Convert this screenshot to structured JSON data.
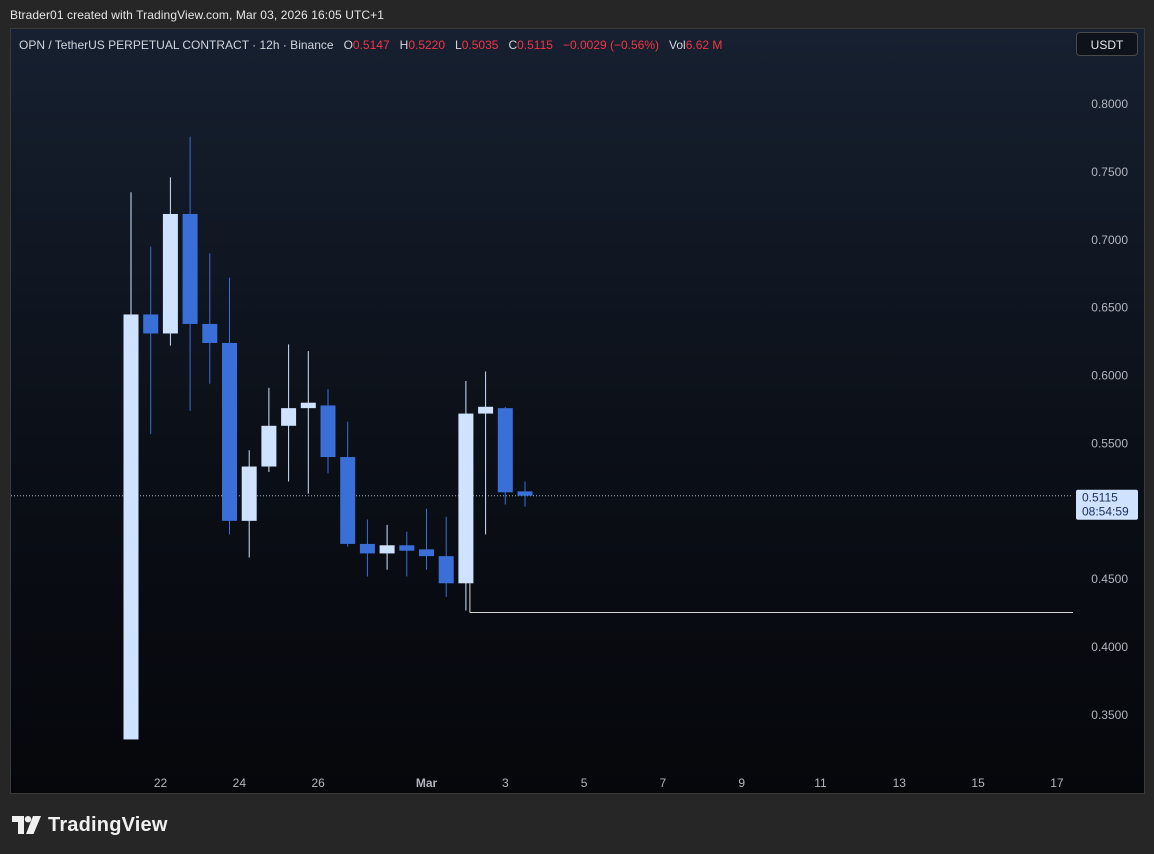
{
  "header": {
    "author_line": "Btrader01 created with TradingView.com, Mar 03, 2026 16:05 UTC+1"
  },
  "legend": {
    "symbol": "OPN / TetherUS PERPETUAL CONTRACT · 12h · Binance",
    "o_label": "O",
    "o_value": "0.5147",
    "h_label": "H",
    "h_value": "0.5220",
    "l_label": "L",
    "l_value": "0.5035",
    "c_label": "C",
    "c_value": "0.5115",
    "change": "−0.0029 (−0.56%)",
    "vol_label": "Vol",
    "vol_value": "6.62 M"
  },
  "currency_button": "USDT",
  "price_tag": {
    "price": "0.5115",
    "countdown": "08:54:59"
  },
  "footer": {
    "brand": "TradingView"
  },
  "colors": {
    "up": "#cfe2ff",
    "down": "#3a6fd8",
    "legend_value": "#f23645",
    "price_tag_bg": "#cfe2ff",
    "price_tag_text": "#1a2f5a"
  },
  "chart_data": {
    "type": "candlestick",
    "y_ticks": [
      "0.8000",
      "0.7500",
      "0.7000",
      "0.6500",
      "0.6000",
      "0.5500",
      "0.4500",
      "0.4000",
      "0.3500"
    ],
    "x_ticks": [
      "22",
      "24",
      "26",
      "Mar",
      "3",
      "5",
      "7",
      "9",
      "11",
      "13",
      "15",
      "17"
    ],
    "ylim": [
      0.32,
      0.84
    ],
    "current_price": 0.5115,
    "horizontal_line": {
      "price": 0.4255,
      "from_candle": 17
    },
    "candles": [
      {
        "o": 0.332,
        "h": 0.735,
        "l": 0.332,
        "c": 0.645
      },
      {
        "o": 0.645,
        "h": 0.695,
        "l": 0.557,
        "c": 0.631
      },
      {
        "o": 0.631,
        "h": 0.746,
        "l": 0.622,
        "c": 0.719
      },
      {
        "o": 0.719,
        "h": 0.776,
        "l": 0.574,
        "c": 0.638
      },
      {
        "o": 0.638,
        "h": 0.69,
        "l": 0.594,
        "c": 0.624
      },
      {
        "o": 0.624,
        "h": 0.672,
        "l": 0.483,
        "c": 0.493
      },
      {
        "o": 0.493,
        "h": 0.545,
        "l": 0.466,
        "c": 0.533
      },
      {
        "o": 0.533,
        "h": 0.591,
        "l": 0.529,
        "c": 0.563
      },
      {
        "o": 0.563,
        "h": 0.623,
        "l": 0.522,
        "c": 0.576
      },
      {
        "o": 0.576,
        "h": 0.618,
        "l": 0.513,
        "c": 0.58
      },
      {
        "o": 0.578,
        "h": 0.59,
        "l": 0.528,
        "c": 0.54
      },
      {
        "o": 0.54,
        "h": 0.566,
        "l": 0.474,
        "c": 0.476
      },
      {
        "o": 0.476,
        "h": 0.494,
        "l": 0.452,
        "c": 0.469
      },
      {
        "o": 0.469,
        "h": 0.49,
        "l": 0.457,
        "c": 0.475
      },
      {
        "o": 0.475,
        "h": 0.485,
        "l": 0.452,
        "c": 0.471
      },
      {
        "o": 0.472,
        "h": 0.502,
        "l": 0.457,
        "c": 0.467
      },
      {
        "o": 0.467,
        "h": 0.496,
        "l": 0.437,
        "c": 0.447
      },
      {
        "o": 0.447,
        "h": 0.596,
        "l": 0.427,
        "c": 0.572
      },
      {
        "o": 0.572,
        "h": 0.603,
        "l": 0.483,
        "c": 0.577
      },
      {
        "o": 0.576,
        "h": 0.577,
        "l": 0.505,
        "c": 0.514
      },
      {
        "o": 0.5147,
        "h": 0.522,
        "l": 0.5035,
        "c": 0.5115
      }
    ]
  }
}
